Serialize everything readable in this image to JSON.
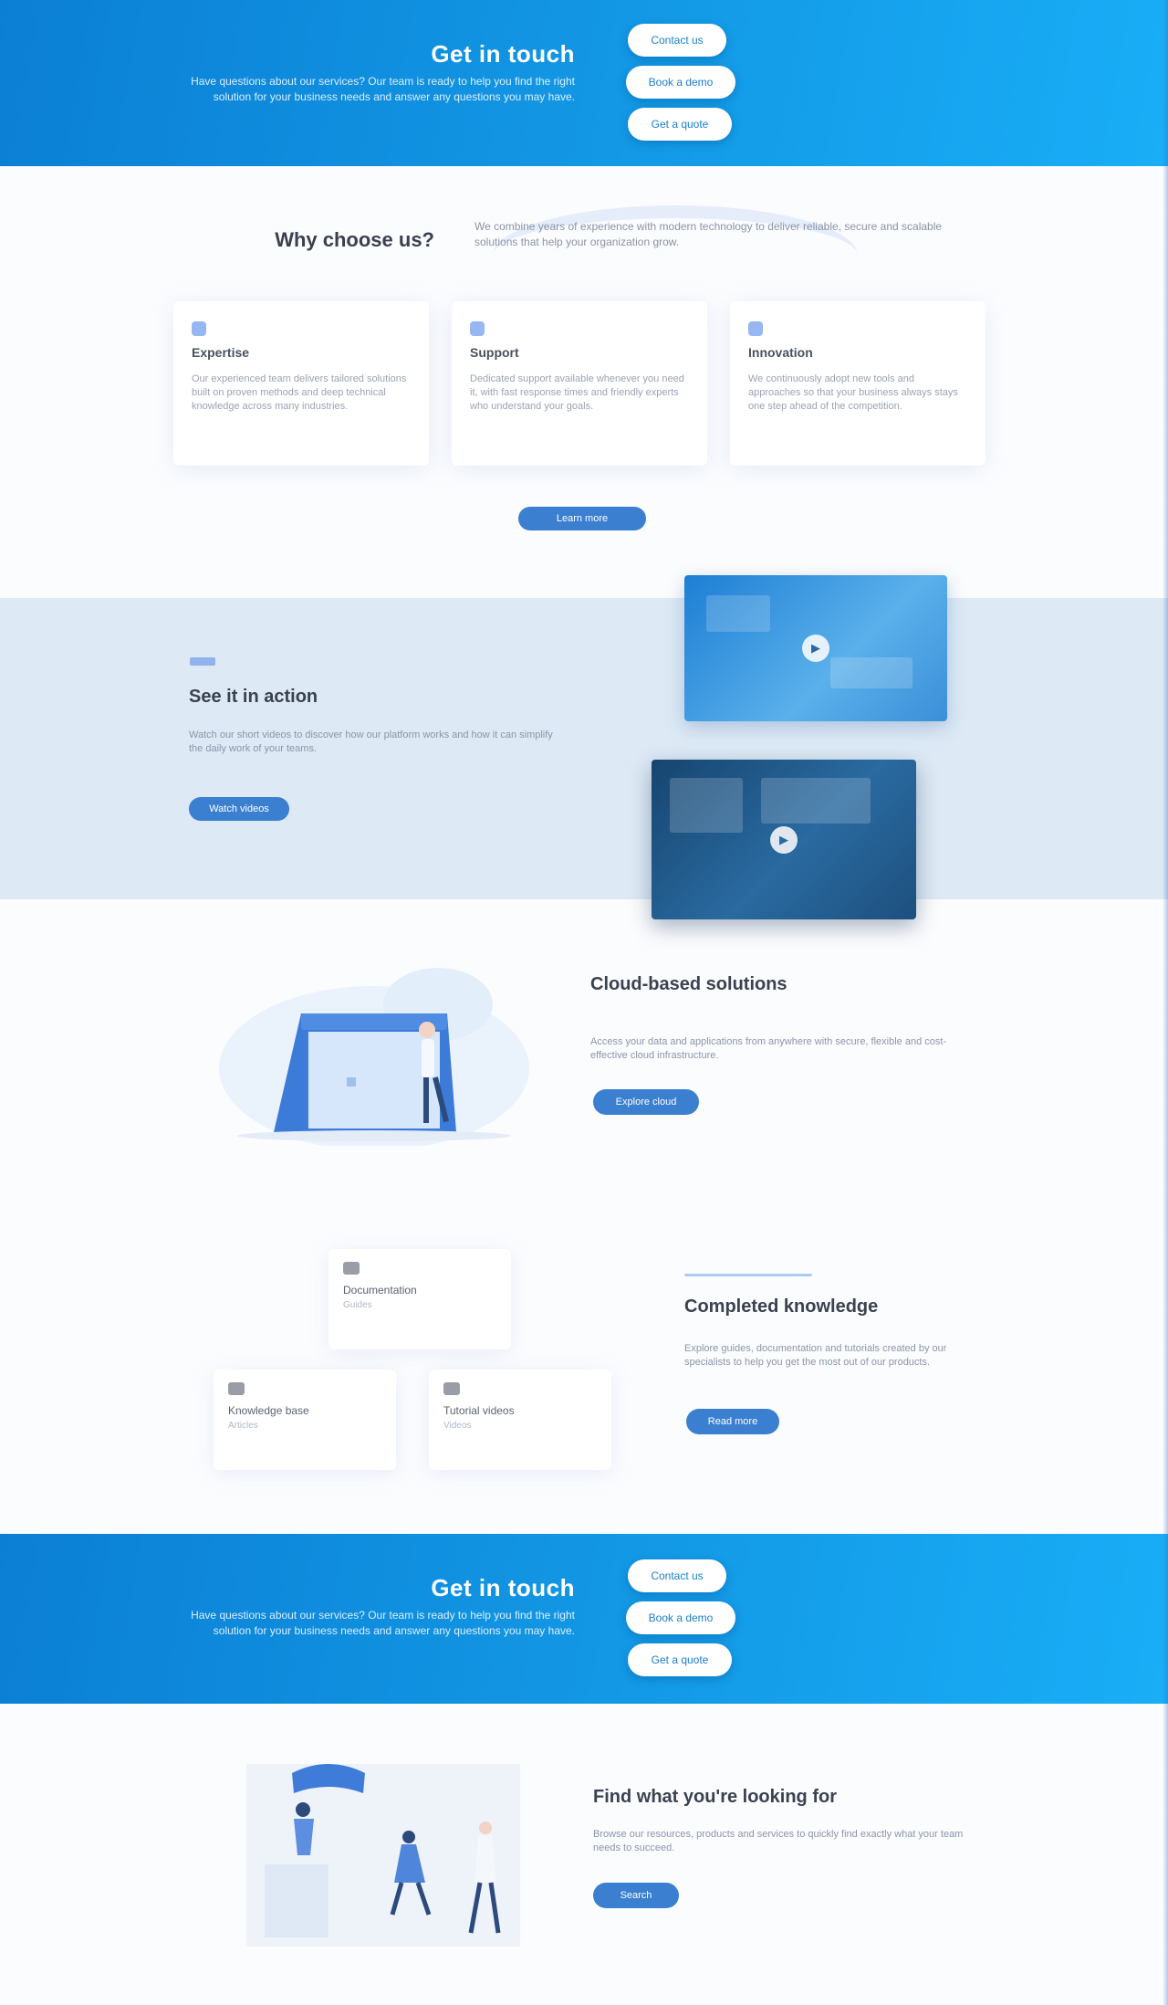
{
  "hero_top": {
    "title": "Get in touch",
    "subtitle": "Have questions about our services? Our team is ready to help you find the right solution for your business needs and answer any questions you may have.",
    "buttons": [
      "Contact us",
      "Book a demo",
      "Get a quote"
    ]
  },
  "why": {
    "heading": "Why choose us?",
    "description": "We combine years of experience with modern technology to deliver reliable, secure and scalable solutions that help your organization grow.",
    "cards": [
      {
        "icon": "settings-icon",
        "title": "Expertise",
        "text": "Our experienced team delivers tailored solutions built on proven methods and deep technical knowledge across many industries."
      },
      {
        "icon": "shield-icon",
        "title": "Support",
        "text": "Dedicated support available whenever you need it, with fast response times and friendly experts who understand your goals."
      },
      {
        "icon": "chart-icon",
        "title": "Innovation",
        "text": "We continuously adopt new tools and approaches so that your business always stays one step ahead of the competition."
      }
    ],
    "button": "Learn more"
  },
  "video_band": {
    "title": "See it in action",
    "text": "Watch our short videos to discover how our platform works and how it can simplify the daily work of your teams.",
    "button": "Watch videos"
  },
  "cloud": {
    "title": "Cloud-based solutions",
    "text": "Access your data and applications from anywhere with secure, flexible and cost-effective cloud infrastructure.",
    "button": "Explore cloud"
  },
  "knowledge": {
    "title": "Completed knowledge",
    "text": "Explore guides, documentation and tutorials created by our specialists to help you get the most out of our products.",
    "button": "Read more",
    "cards": [
      {
        "title": "Documentation",
        "sub": "Guides"
      },
      {
        "title": "Knowledge base",
        "sub": "Articles"
      },
      {
        "title": "Tutorial videos",
        "sub": "Videos"
      }
    ]
  },
  "hero_mid": {
    "title": "Get in touch",
    "subtitle": "Have questions about our services? Our team is ready to help you find the right solution for your business needs and answer any questions you may have.",
    "buttons": [
      "Contact us",
      "Book a demo",
      "Get a quote"
    ]
  },
  "find": {
    "title": "Find what you're looking for",
    "text": "Browse our resources, products and services to quickly find exactly what your team needs to succeed.",
    "button": "Search"
  },
  "colors": {
    "primary": "#1399e6",
    "button": "#3b7fd0",
    "band": "#dde9f5"
  }
}
